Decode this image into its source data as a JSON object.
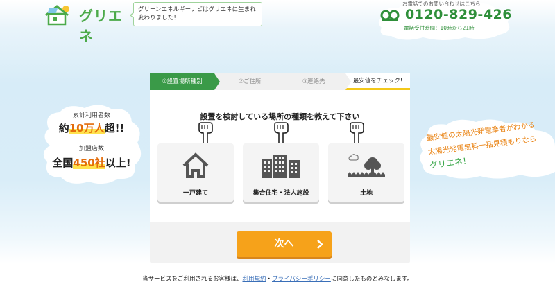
{
  "header": {
    "logo_text": "グリエネ",
    "tagline": "グリーンエネルギーナビはグリエネに生まれ変わりました！",
    "phone_caption": "お電話でのお問い合わせはこちら",
    "phone_number": "0120-829-426",
    "phone_hours": "電話受付時間：10時から21時"
  },
  "badge": {
    "users_label": "累計利用者数",
    "users_value_prefix": "約",
    "users_value": "10万人",
    "users_value_suffix": "超!!",
    "stores_label": "加盟店数",
    "stores_value_prefix": "全国",
    "stores_value": "450社",
    "stores_value_suffix": "以上!"
  },
  "slogan": {
    "line1": "最安値の太陽光発電業者がわかる",
    "line2": "太陽光発電無料一括見積もりなら",
    "line3": "グリエネ！"
  },
  "steps": [
    {
      "label": "①設置場所種別"
    },
    {
      "label": "②ご住所"
    },
    {
      "label": "③連絡先"
    },
    {
      "label": "最安値をチェック!"
    }
  ],
  "form": {
    "question": "設置を検討している場所の種類を教えて下さい",
    "options": [
      {
        "label": "一戸建て",
        "icon": "house-icon"
      },
      {
        "label": "集合住宅・法人施設",
        "icon": "building-icon"
      },
      {
        "label": "土地",
        "icon": "land-icon"
      }
    ],
    "next_label": "次へ"
  },
  "footer": {
    "prefix": "当サービスをご利用されるお客様は、",
    "terms_link": "利用規約",
    "separator": "・",
    "privacy_link": "プライバシーポリシー",
    "suffix": "に同意したものとみなします。"
  },
  "colors": {
    "brand_green": "#3a9a48",
    "accent_orange": "#f6a21a",
    "highlight_yellow": "#ffe24d"
  }
}
